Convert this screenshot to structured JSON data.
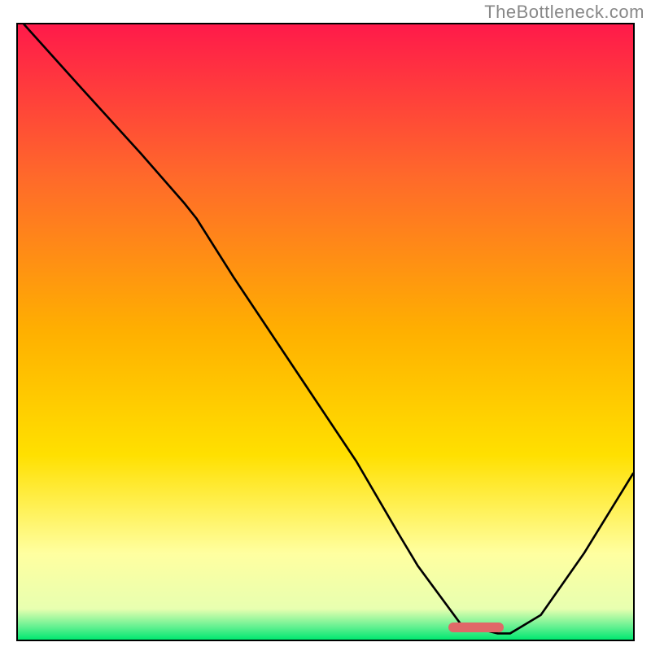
{
  "watermark": "TheBottleneck.com",
  "colors": {
    "top": "#ff1a4a",
    "mid_upper": "#ff6a2a",
    "mid": "#ffb000",
    "mid_lower": "#ffe000",
    "pale": "#ffffa0",
    "green": "#00e870",
    "marker": "#e06868",
    "line": "#000000",
    "border": "#000000"
  },
  "chart_data": {
    "type": "line",
    "title": "",
    "xlabel": "",
    "ylabel": "",
    "xlim": [
      0,
      100
    ],
    "ylim": [
      0,
      100
    ],
    "grid": false,
    "note": "Axes unlabeled in source image; x and y are in percent of plot area. y=0 is bottom (optimal / green), y=100 is top (worst / red). Curve traced from pixel positions.",
    "series": [
      {
        "name": "bottleneck-curve",
        "x": [
          1,
          10,
          20,
          27,
          29,
          35,
          45,
          55,
          62,
          65,
          72,
          78,
          80,
          85,
          92,
          100
        ],
        "y": [
          100,
          90,
          79,
          71,
          68.5,
          59,
          44,
          29,
          17,
          12,
          2.5,
          1.0,
          1.0,
          4,
          14,
          27
        ]
      }
    ],
    "marker": {
      "name": "optimal-range",
      "x_start": 70,
      "x_end": 79,
      "y": 1.2,
      "color": "#e06868"
    },
    "gradient_stops_pct_from_top": [
      {
        "pct": 0,
        "color": "#ff1a4a"
      },
      {
        "pct": 25,
        "color": "#ff6a2a"
      },
      {
        "pct": 50,
        "color": "#ffb000"
      },
      {
        "pct": 70,
        "color": "#ffe000"
      },
      {
        "pct": 86,
        "color": "#ffffa0"
      },
      {
        "pct": 95,
        "color": "#e8ffb0"
      },
      {
        "pct": 98,
        "color": "#60f090"
      },
      {
        "pct": 100,
        "color": "#00e870"
      }
    ]
  }
}
